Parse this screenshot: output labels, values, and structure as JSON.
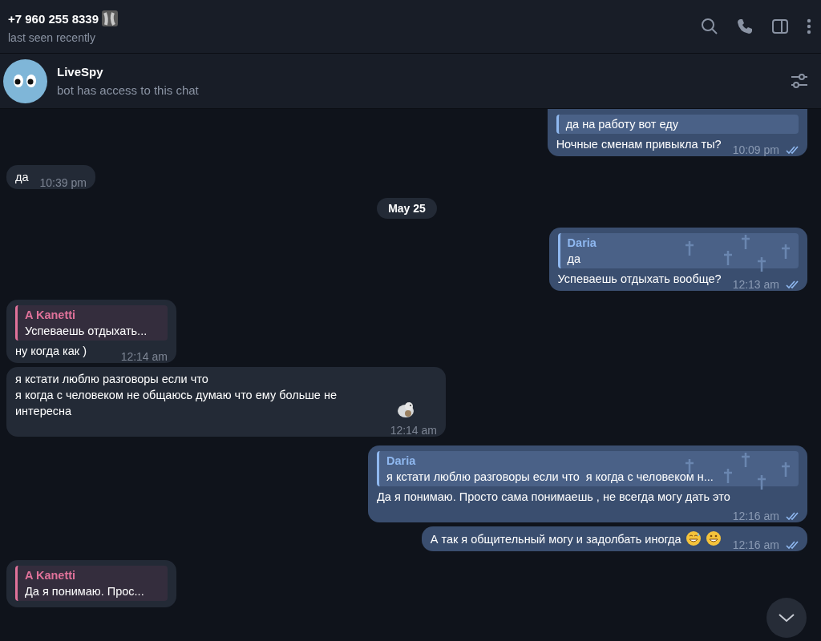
{
  "header": {
    "title": "+7 960 255 8339",
    "status": "last seen recently"
  },
  "bot_bar": {
    "name": "LiveSpy",
    "subtitle": "bot has access to this chat"
  },
  "messages": [
    {
      "kind": "outgoing",
      "reply": {
        "text": "да на работу вот еду",
        "color": "#8fb8f0"
      },
      "text": "Ночные сменам привыкла ты?",
      "time": "10:09 pm",
      "read": true
    },
    {
      "kind": "incoming",
      "text": "да",
      "time": "10:39 pm"
    },
    {
      "kind": "date",
      "text": "May 25"
    },
    {
      "kind": "outgoing",
      "reply": {
        "name": "Daria",
        "text": "да",
        "color": "#8fb8f0"
      },
      "text": "Успеваешь отдыхать вообще?",
      "time": "12:13 am",
      "read": true
    },
    {
      "kind": "incoming",
      "reply": {
        "name": "A Kanetti",
        "text": "Успеваешь отдыхать...",
        "color": "#e0729a"
      },
      "text": "ну когда как )",
      "time": "12:14 am"
    },
    {
      "kind": "incoming",
      "text": "я кстати люблю разговоры если что\nя когда с человеком не общаюсь думаю что ему больше не интересна",
      "sticker": true,
      "time": "12:14 am"
    },
    {
      "kind": "outgoing",
      "reply": {
        "name": "Daria",
        "text": "я кстати люблю разговоры если что  я когда с человеком н...",
        "color": "#8fb8f0"
      },
      "text": "Да я понимаю. Просто сама понимаешь , не всегда могу дать это",
      "time": "12:16 am",
      "read": true
    },
    {
      "kind": "outgoing",
      "text": "А так я общительный могу и задолбать иногда",
      "emoji": true,
      "time": "12:16 am",
      "read": true
    },
    {
      "kind": "incoming",
      "reply": {
        "name": "A Kanetti",
        "text": "Да я понимаю. Прос...",
        "color": "#e0729a"
      }
    }
  ]
}
